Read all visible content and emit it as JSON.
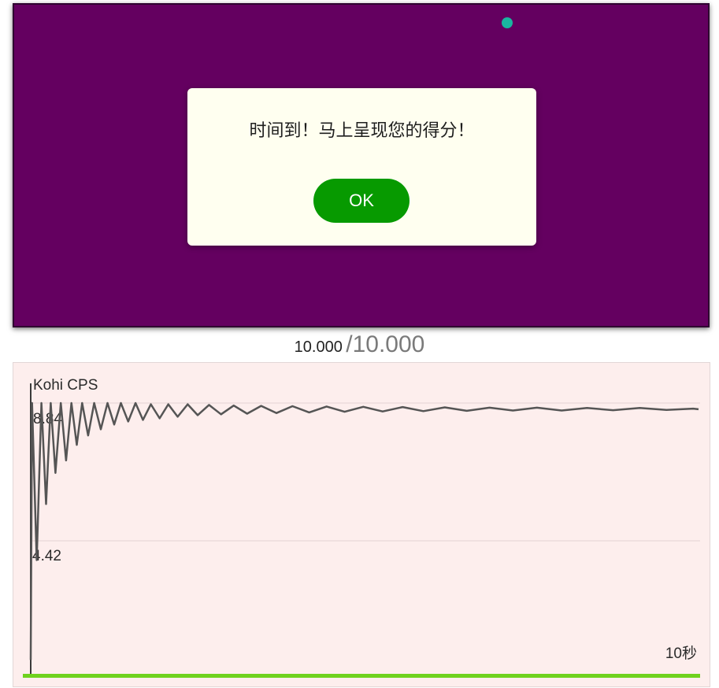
{
  "colors": {
    "arena": "#640060",
    "click_dot": "#19b6a0",
    "dialog_bg": "#fffff0",
    "ok_button": "#079a00",
    "chart_bg": "#fdeeed",
    "cps_line": "#555555",
    "progress_bar": "#6fd21e"
  },
  "dialog": {
    "message": "时间到！马上呈现您的得分！",
    "ok_label": "OK"
  },
  "timer": {
    "elapsed": "10.000",
    "total": "/10.000"
  },
  "chart_data": {
    "type": "line",
    "title": "Kohi CPS",
    "y_ticks": [
      "8.84",
      "4.42"
    ],
    "ylim": [
      0,
      8.84
    ],
    "xlabel": "10秒",
    "xlim": [
      0,
      10
    ],
    "grid": true,
    "series": [
      {
        "values": [
          [
            0.0,
            0.6
          ],
          [
            0.02,
            8.84
          ],
          [
            0.09,
            3.8
          ],
          [
            0.16,
            8.84
          ],
          [
            0.23,
            5.6
          ],
          [
            0.3,
            8.84
          ],
          [
            0.37,
            6.6
          ],
          [
            0.45,
            8.84
          ],
          [
            0.53,
            7.0
          ],
          [
            0.61,
            8.84
          ],
          [
            0.69,
            7.5
          ],
          [
            0.77,
            8.84
          ],
          [
            0.86,
            7.8
          ],
          [
            0.95,
            8.84
          ],
          [
            1.05,
            8.0
          ],
          [
            1.15,
            8.84
          ],
          [
            1.25,
            8.15
          ],
          [
            1.35,
            8.84
          ],
          [
            1.46,
            8.25
          ],
          [
            1.57,
            8.84
          ],
          [
            1.68,
            8.3
          ],
          [
            1.8,
            8.8
          ],
          [
            1.93,
            8.35
          ],
          [
            2.06,
            8.8
          ],
          [
            2.2,
            8.4
          ],
          [
            2.35,
            8.8
          ],
          [
            2.5,
            8.45
          ],
          [
            2.67,
            8.78
          ],
          [
            2.85,
            8.48
          ],
          [
            3.04,
            8.76
          ],
          [
            3.24,
            8.5
          ],
          [
            3.45,
            8.75
          ],
          [
            3.68,
            8.52
          ],
          [
            3.92,
            8.74
          ],
          [
            4.17,
            8.54
          ],
          [
            4.43,
            8.73
          ],
          [
            4.7,
            8.56
          ],
          [
            4.98,
            8.72
          ],
          [
            5.27,
            8.57
          ],
          [
            5.57,
            8.71
          ],
          [
            5.88,
            8.58
          ],
          [
            6.2,
            8.7
          ],
          [
            6.53,
            8.59
          ],
          [
            6.87,
            8.69
          ],
          [
            7.22,
            8.6
          ],
          [
            7.58,
            8.69
          ],
          [
            7.95,
            8.6
          ],
          [
            8.33,
            8.68
          ],
          [
            8.72,
            8.61
          ],
          [
            9.12,
            8.68
          ],
          [
            9.52,
            8.62
          ],
          [
            9.92,
            8.66
          ],
          [
            10.0,
            8.64
          ]
        ]
      }
    ],
    "progress": 1.0
  }
}
